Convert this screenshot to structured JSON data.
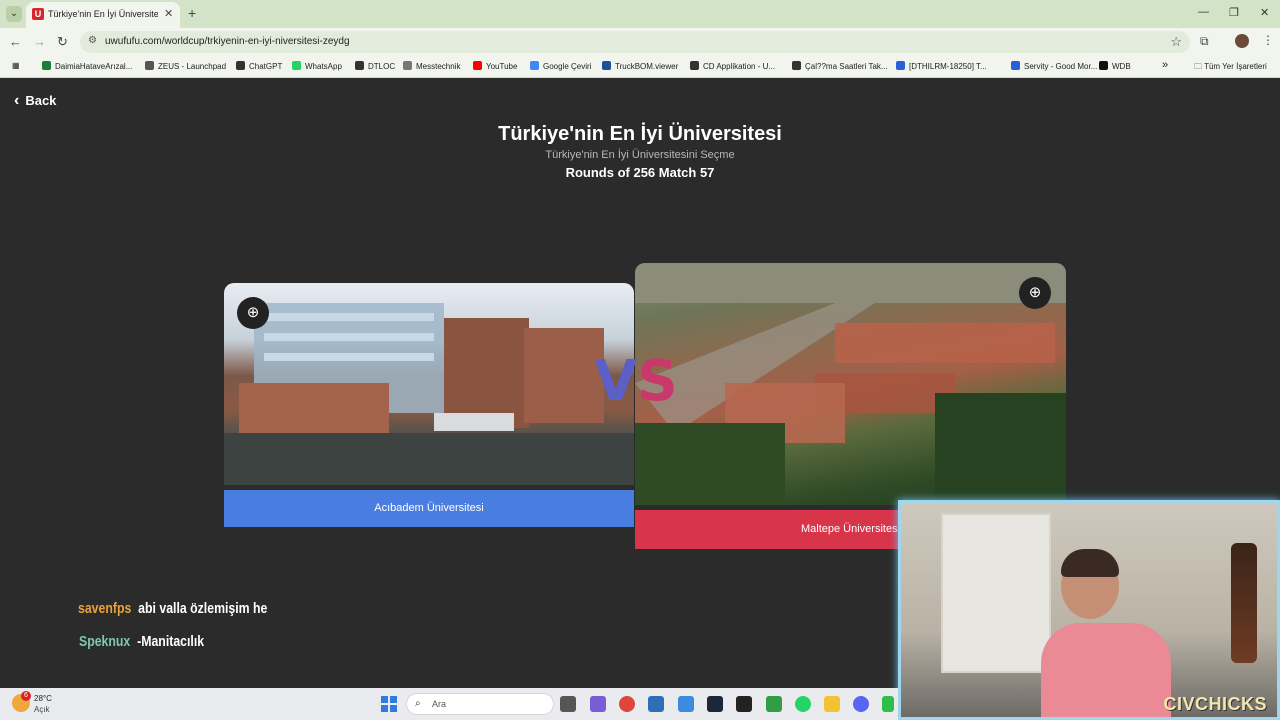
{
  "browser": {
    "tab_title": "Türkiye'nin En İyi Üniversitesi | U",
    "tab_favicon": "U",
    "url": "uwufufu.com/worldcup/trkiyenin-en-iyi-niversitesi-zeydg",
    "win_minimize": "—",
    "win_restore": "❐",
    "win_close": "✕"
  },
  "bookmarks": [
    {
      "label": "DaimiaHataveArızal...",
      "color": "#1a7f37"
    },
    {
      "label": "ZEUS - Launchpad",
      "color": "#555555"
    },
    {
      "label": "ChatGPT",
      "color": "#333333"
    },
    {
      "label": "WhatsApp",
      "color": "#25d366"
    },
    {
      "label": "DTLOC",
      "color": "#333333"
    },
    {
      "label": "Messtechnik",
      "color": "#777777"
    },
    {
      "label": "YouTube",
      "color": "#ff0000"
    },
    {
      "label": "Google Çeviri",
      "color": "#4285f4"
    },
    {
      "label": "TruckBOM.viewer",
      "color": "#1f4f9a"
    },
    {
      "label": "CD Applikation - U...",
      "color": "#333333"
    },
    {
      "label": "Çal??ma Saatleri Tak...",
      "color": "#333333"
    },
    {
      "label": "[DTHILRM-18250] T...",
      "color": "#2b5fd9"
    },
    {
      "label": "Servity - Good Mor...",
      "color": "#2b5fd9"
    },
    {
      "label": "WDB",
      "color": "#111111"
    }
  ],
  "bookmarks_more": "»",
  "all_bookmarks": "Tüm Yer İşaretleri",
  "page": {
    "back_label": "Back",
    "title": "Türkiye'nin En İyi Üniversitesi",
    "subtitle": "Türkiye'nin En İyi Üniversitesini Seçme",
    "rounds": "Rounds of 256 Match 57",
    "left_choice": "Acıbadem Üniversitesi",
    "right_choice": "Maltepe Üniversitesi",
    "vs_v": "V",
    "vs_s": "S"
  },
  "chat": [
    {
      "user": "savenfps",
      "message": "abi valla özlemişim he"
    },
    {
      "user": "Speknux",
      "message": "-Manitacılık"
    }
  ],
  "webcam": {
    "brand": "CIVCHICKS"
  },
  "taskbar": {
    "notification_count": "6",
    "temperature": "28°C",
    "condition": "Açık",
    "search_placeholder": "Ara"
  },
  "colors": {
    "left_button": "#4a7de0",
    "right_button": "#d8344a",
    "background": "#2b2b2b"
  }
}
